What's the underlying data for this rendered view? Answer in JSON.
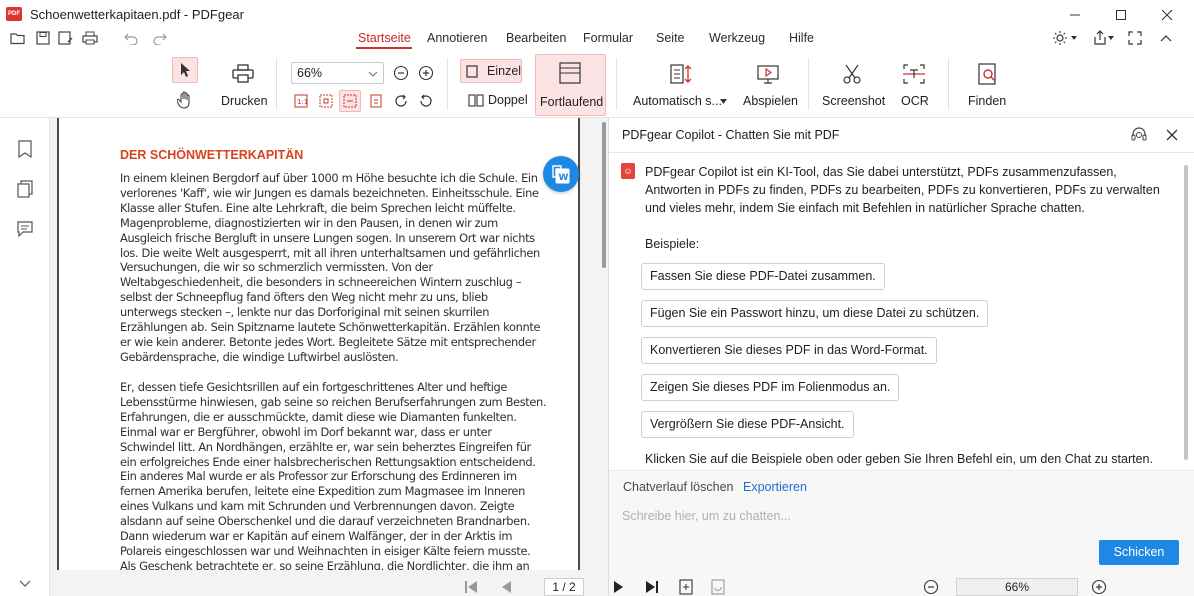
{
  "window": {
    "title": "Schoenwetterkapitaen.pdf - PDFgear",
    "app_icon_text": "PDF"
  },
  "menu": {
    "tabs": [
      {
        "label": "Startseite",
        "active": true
      },
      {
        "label": "Annotieren"
      },
      {
        "label": "Bearbeiten"
      },
      {
        "label": "Formular"
      },
      {
        "label": "Seite"
      },
      {
        "label": "Werkzeug"
      },
      {
        "label": "Hilfe"
      }
    ]
  },
  "ribbon": {
    "print_label": "Drucken",
    "zoom_value": "66%",
    "single_label": "Einzel",
    "double_label": "Doppel",
    "continuous_label": "Fortlaufend",
    "auto_scroll_label": "Automatisch s...",
    "play_label": "Abspielen",
    "screenshot_label": "Screenshot",
    "ocr_label": "OCR",
    "find_label": "Finden"
  },
  "document": {
    "heading": "DER SCHÖNWETTERKAPITÄN",
    "paragraph1": [
      "In einem kleinen Bergdorf auf über 1000 m Höhe besuchte ich die Schule. Ein",
      "verlorenes 'Kaff', wie wir Jungen es damals bezeichneten. Einheitsschule. Eine",
      "Klasse aller Stufen. Eine alte Lehrkraft, die beim Sprechen leicht müffelte.",
      "Magenprobleme, diagnostizierten wir in den Pausen, in denen wir zum",
      "Ausgleich frische Bergluft in unsere Lungen sogen. In unserem Ort war nichts",
      "los. Die weite Welt ausgesperrt, mit all ihren unterhaltsamen und gefährlichen",
      "Versuchungen, die wir so schmerzlich vermissten. Von der",
      "Weltabgeschiedenheit, die besonders in schneereichen Wintern zuschlug –",
      "selbst der Schneepflug fand öfters den Weg nicht mehr zu uns, blieb",
      "unterwegs stecken –, lenkte nur das Dorforiginal mit seinen skurrilen",
      "Erzählungen ab. Sein Spitzname lautete Schönwetterkapitän. Erzählen konnte",
      "er wie kein anderer. Betonte jedes Wort. Begleitete Sätze mit entsprechender",
      "Gebärdensprache, die windige Luftwirbel auslösten."
    ],
    "paragraph2": [
      "Er, dessen tiefe Gesichtsrillen auf ein fortgeschrittenes Alter und heftige",
      "Lebensstürme hinwiesen, gab seine so reichen Berufserfahrungen zum Besten.",
      "Erfahrungen, die er ausschmückte, damit diese wie Diamanten funkelten.",
      "Einmal war er Bergführer, obwohl im Dorf bekannt war, dass er unter",
      "Schwindel litt. An Nordhängen, erzählte er, war sein beherztes Eingreifen für",
      "ein erfolgreiches Ende einer halsbrecherischen Rettungsaktion entscheidend.",
      "Ein anderes Mal wurde er als Professor zur Erforschung des Erdinneren im",
      "fernen Amerika berufen, leitete eine Expedition zum Magmasee im Inneren",
      "eines Vulkans und kam mit Schrunden und Verbrennungen davon. Zeigte",
      "alsdann auf seine Oberschenkel und die darauf verzeichneten Brandnarben.",
      "Dann wiederum war er Kapitän auf einem Walfänger, der in der Arktis im",
      "Polareis eingeschlossen war und Weihnachten in eisiger Kälte feiern musste.",
      "Als Geschenk betrachtete er, so seine Erzählung, die Nordlichter, die ihm an"
    ]
  },
  "copilot": {
    "title": "PDFgear Copilot - Chatten Sie mit PDF",
    "intro": "PDFgear Copilot ist ein KI-Tool, das Sie dabei unterstützt, PDFs zusammenzufassen, Antworten in PDFs zu finden, PDFs zu bearbeiten, PDFs zu konvertieren, PDFs zu verwalten und vieles mehr, indem Sie einfach mit Befehlen in natürlicher Sprache chatten.",
    "examples_label": "Beispiele:",
    "examples": [
      "Fassen Sie diese PDF-Datei zusammen.",
      "Fügen Sie ein Passwort hinzu, um diese Datei zu schützen.",
      "Konvertieren Sie dieses PDF in das Word-Format.",
      "Zeigen Sie dieses PDF im Folienmodus an.",
      "Vergrößern Sie diese PDF-Ansicht."
    ],
    "hint": "Klicken Sie auf die Beispiele oben oder geben Sie Ihren Befehl ein, um den Chat zu starten.",
    "clear_history": "Chatverlauf löschen",
    "export": "Exportieren",
    "input_placeholder": "Schreibe hier, um zu chatten...",
    "send": "Schicken"
  },
  "navigation": {
    "page_display": "1 / 2",
    "zoom_display": "66%"
  },
  "colors": {
    "accent_red": "#d32f2f",
    "heading_orange": "#d8431f",
    "primary_blue": "#1e88e5"
  }
}
